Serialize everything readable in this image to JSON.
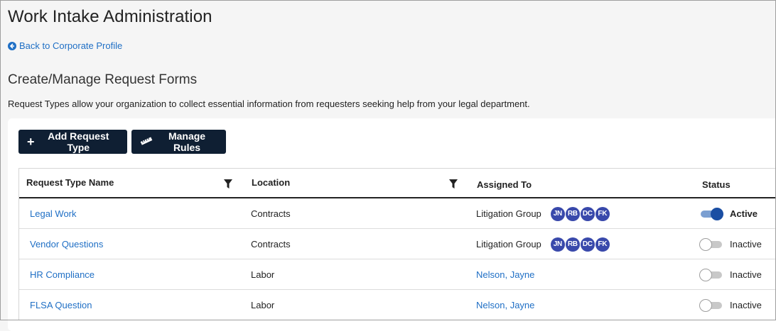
{
  "page": {
    "title": "Work Intake Administration",
    "back_link": "Back to Corporate Profile",
    "section_title": "Create/Manage Request Forms",
    "description": "Request Types allow your organization to collect essential information from requesters seeking help from your legal department."
  },
  "toolbar": {
    "add_label": "Add Request Type",
    "rules_label": "Manage Rules"
  },
  "table": {
    "columns": [
      "Request Type Name",
      "Location",
      "Assigned To",
      "Status"
    ],
    "rows": [
      {
        "name": "Legal Work",
        "location": "Contracts",
        "assigned": "Litigation Group",
        "avatars": [
          "JN",
          "RB",
          "DC",
          "FK"
        ],
        "status": "Active"
      },
      {
        "name": "Vendor Questions",
        "location": "Contracts",
        "assigned": "Litigation Group",
        "avatars": [
          "JN",
          "RB",
          "DC",
          "FK"
        ],
        "status": "Inactive"
      },
      {
        "name": "HR Compliance",
        "location": "Labor",
        "assigned": "Nelson, Jayne",
        "avatars": [],
        "status": "Inactive"
      },
      {
        "name": "FLSA Question",
        "location": "Labor",
        "assigned": "Nelson, Jayne",
        "avatars": [],
        "status": "Inactive"
      }
    ]
  },
  "colors": {
    "link": "#1f6fc5",
    "button_bg": "#0f1f33",
    "avatar_bg": "#3949ab",
    "toggle_on": "#1a4ea3"
  },
  "icons": {
    "back": "arrow-circle-left-icon",
    "add": "plus-icon",
    "rules": "ruler-icon",
    "filter": "filter-icon"
  }
}
